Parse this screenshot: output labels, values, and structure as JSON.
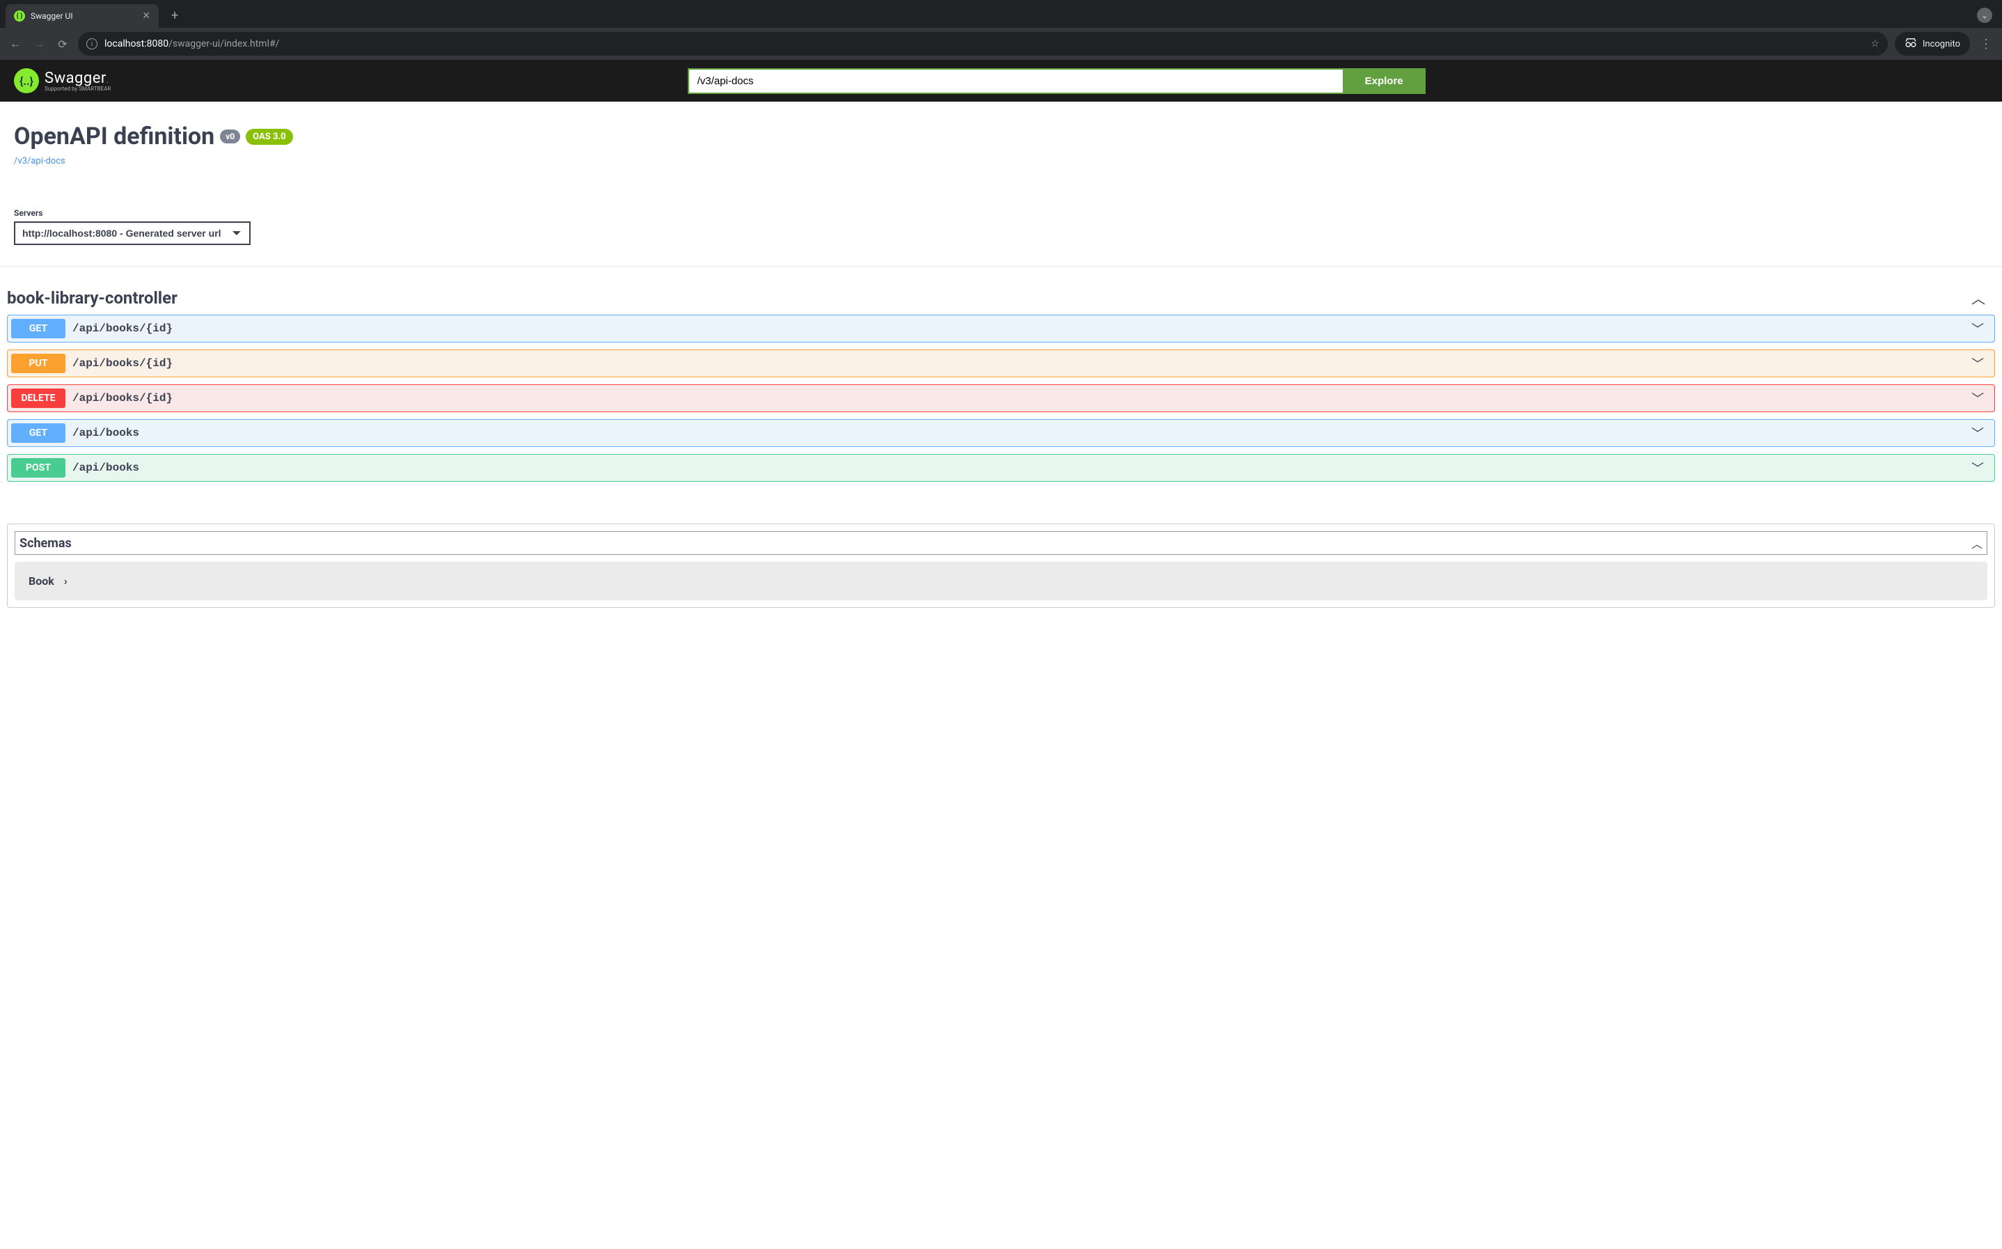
{
  "browser": {
    "tab_title": "Swagger UI",
    "url_host": "localhost:8080",
    "url_path": "/swagger-ui/index.html#/",
    "incognito_label": "Incognito"
  },
  "topbar": {
    "logo_text": "Swagger",
    "logo_sub": "Supported by SMARTBEAR",
    "input_value": "/v3/api-docs",
    "explore_label": "Explore"
  },
  "info": {
    "title": "OpenAPI definition",
    "version_badge": "v0",
    "oas_badge": "OAS 3.0",
    "docs_link": "/v3/api-docs"
  },
  "servers": {
    "label": "Servers",
    "selected": "http://localhost:8080 - Generated server url"
  },
  "tag": {
    "name": "book-library-controller"
  },
  "operations": [
    {
      "method": "GET",
      "path": "/api/books/{id}",
      "cls": "get"
    },
    {
      "method": "PUT",
      "path": "/api/books/{id}",
      "cls": "put"
    },
    {
      "method": "DELETE",
      "path": "/api/books/{id}",
      "cls": "delete"
    },
    {
      "method": "GET",
      "path": "/api/books",
      "cls": "get"
    },
    {
      "method": "POST",
      "path": "/api/books",
      "cls": "post"
    }
  ],
  "schemas": {
    "header": "Schemas",
    "items": [
      {
        "name": "Book"
      }
    ]
  }
}
